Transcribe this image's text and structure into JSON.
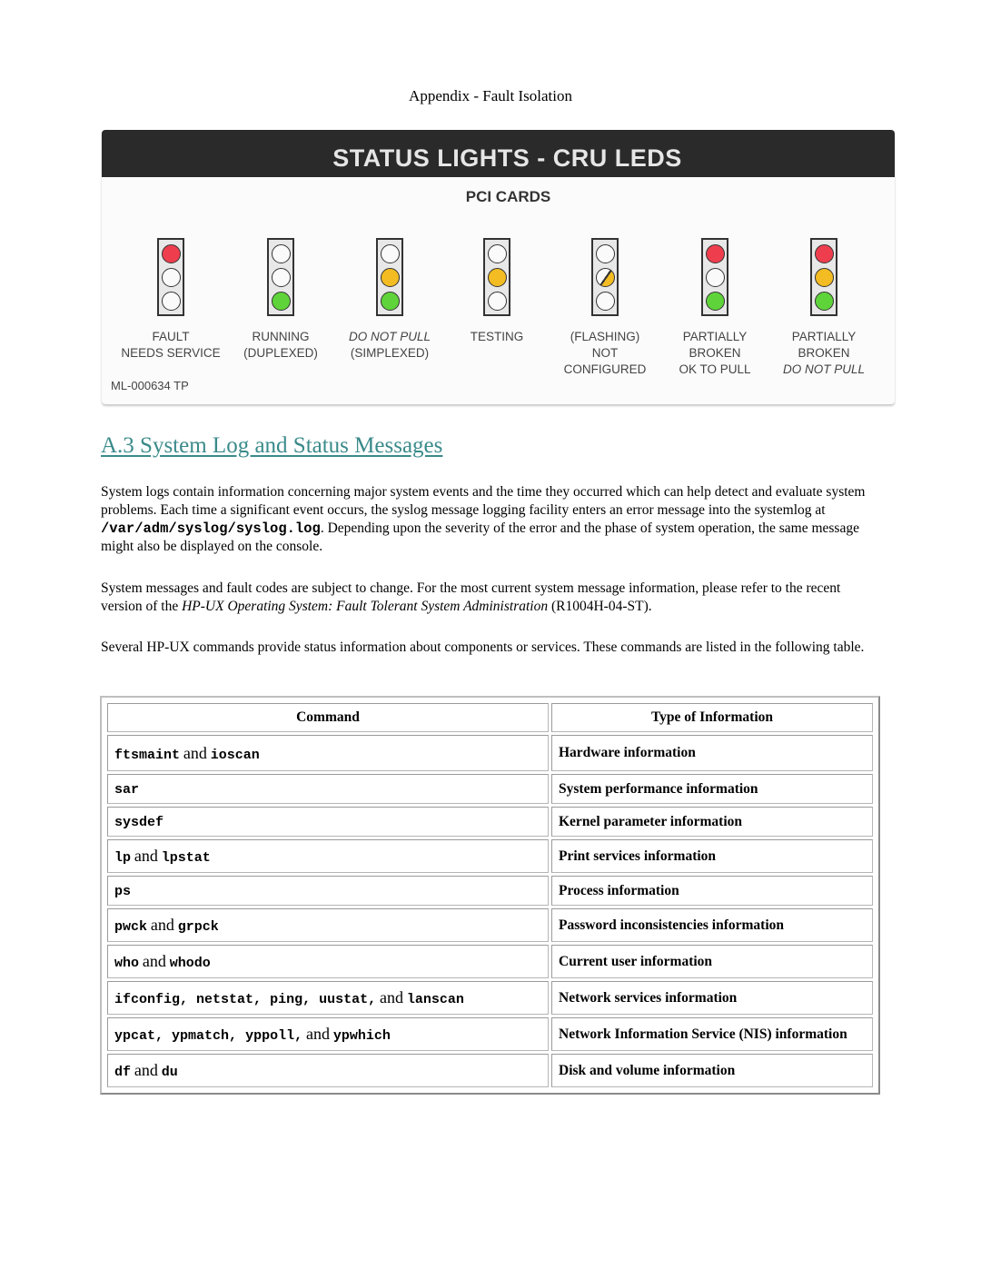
{
  "header": {
    "running_title": "Appendix - Fault Isolation"
  },
  "status_card": {
    "title": "STATUS LIGHTS - CRU LEDS",
    "subtitle": "PCI CARDS",
    "code": "ML-000634   TP",
    "lights": [
      {
        "state": "fault",
        "lamps": [
          "red",
          "off",
          "off"
        ],
        "label_lines": [
          {
            "text": "FAULT",
            "italic": false
          },
          {
            "text": "NEEDS SERVICE",
            "italic": false
          }
        ]
      },
      {
        "state": "running-duplexed",
        "lamps": [
          "off",
          "off",
          "green"
        ],
        "label_lines": [
          {
            "text": "RUNNING",
            "italic": false
          },
          {
            "text": "(DUPLEXED)",
            "italic": false
          }
        ]
      },
      {
        "state": "do-not-pull-simplexed",
        "lamps": [
          "off",
          "amber",
          "green"
        ],
        "label_lines": [
          {
            "text": "DO NOT PULL",
            "italic": true
          },
          {
            "text": "(SIMPLEXED)",
            "italic": false
          }
        ]
      },
      {
        "state": "testing",
        "lamps": [
          "off",
          "amber",
          "off"
        ],
        "label_lines": [
          {
            "text": "TESTING",
            "italic": false
          }
        ]
      },
      {
        "state": "not-configured",
        "lamps": [
          "off",
          "flash",
          "off"
        ],
        "label_lines": [
          {
            "text": "(FLASHING)",
            "italic": false
          },
          {
            "text": "NOT",
            "italic": false
          },
          {
            "text": "CONFIGURED",
            "italic": false
          }
        ]
      },
      {
        "state": "partially-broken-ok",
        "lamps": [
          "red",
          "off",
          "green"
        ],
        "label_lines": [
          {
            "text": "PARTIALLY",
            "italic": false
          },
          {
            "text": "BROKEN",
            "italic": false
          },
          {
            "text": "OK TO PULL",
            "italic": false
          }
        ]
      },
      {
        "state": "partially-broken-do-not-pull",
        "lamps": [
          "red",
          "amber",
          "green"
        ],
        "label_lines": [
          {
            "text": "PARTIALLY",
            "italic": false
          },
          {
            "text": "BROKEN",
            "italic": false
          },
          {
            "text": "DO NOT PULL",
            "italic": true
          }
        ]
      }
    ],
    "colors": {
      "red": "#ee3e4e",
      "amber": "#f2bc22",
      "green": "#5fd43a",
      "bar": "#2a2a2a"
    }
  },
  "section": {
    "title": "A.3 System Log and Status Messages",
    "title_color": "#3a8a8a",
    "para1": {
      "before": "System logs contain information concerning major system events and the time they occurred which can help detect and evaluate system problems. Each time a significant event occurs, the syslog message logging facility enters an error message into the systemlog at ",
      "path": "/var/adm/syslog/syslog.log",
      "after": ". Depending upon the severity of the error and the phase of system operation, the same message might also be displayed on the console."
    },
    "para2": {
      "before": "System messages and fault codes are subject to change. For the most current system message information, please refer to the recent version of the ",
      "book_title": "HP-UX Operating System: Fault Tolerant System Administration",
      "after": " (R1004H-04-ST)."
    },
    "para3": "Several HP-UX commands provide status information about components or services. These commands are listed in the following table."
  },
  "table": {
    "headers": [
      "Command",
      "Type of Information"
    ],
    "rows": [
      {
        "commands": [
          "ftsmaint",
          "ioscan"
        ],
        "info": "Hardware information"
      },
      {
        "commands": [
          "sar"
        ],
        "info": "System performance information"
      },
      {
        "commands": [
          "sysdef"
        ],
        "info": "Kernel parameter information"
      },
      {
        "commands": [
          "lp",
          "lpstat"
        ],
        "info": "Print services information"
      },
      {
        "commands": [
          "ps"
        ],
        "info": "Process information"
      },
      {
        "commands": [
          "pwck",
          "grpck"
        ],
        "info": "Password inconsistencies information"
      },
      {
        "commands": [
          "who",
          "whodo"
        ],
        "info": "Current user information"
      },
      {
        "commands": [
          "ifconfig",
          "netstat",
          "ping",
          "uustat",
          "lanscan"
        ],
        "info": "Network services information"
      },
      {
        "commands": [
          "ypcat",
          "ypmatch",
          "yppoll",
          "ypwhich"
        ],
        "info": "Network Information Service (NIS) information"
      },
      {
        "commands": [
          "df",
          "du"
        ],
        "info": "Disk and volume information"
      }
    ],
    "conjunction": "and"
  }
}
